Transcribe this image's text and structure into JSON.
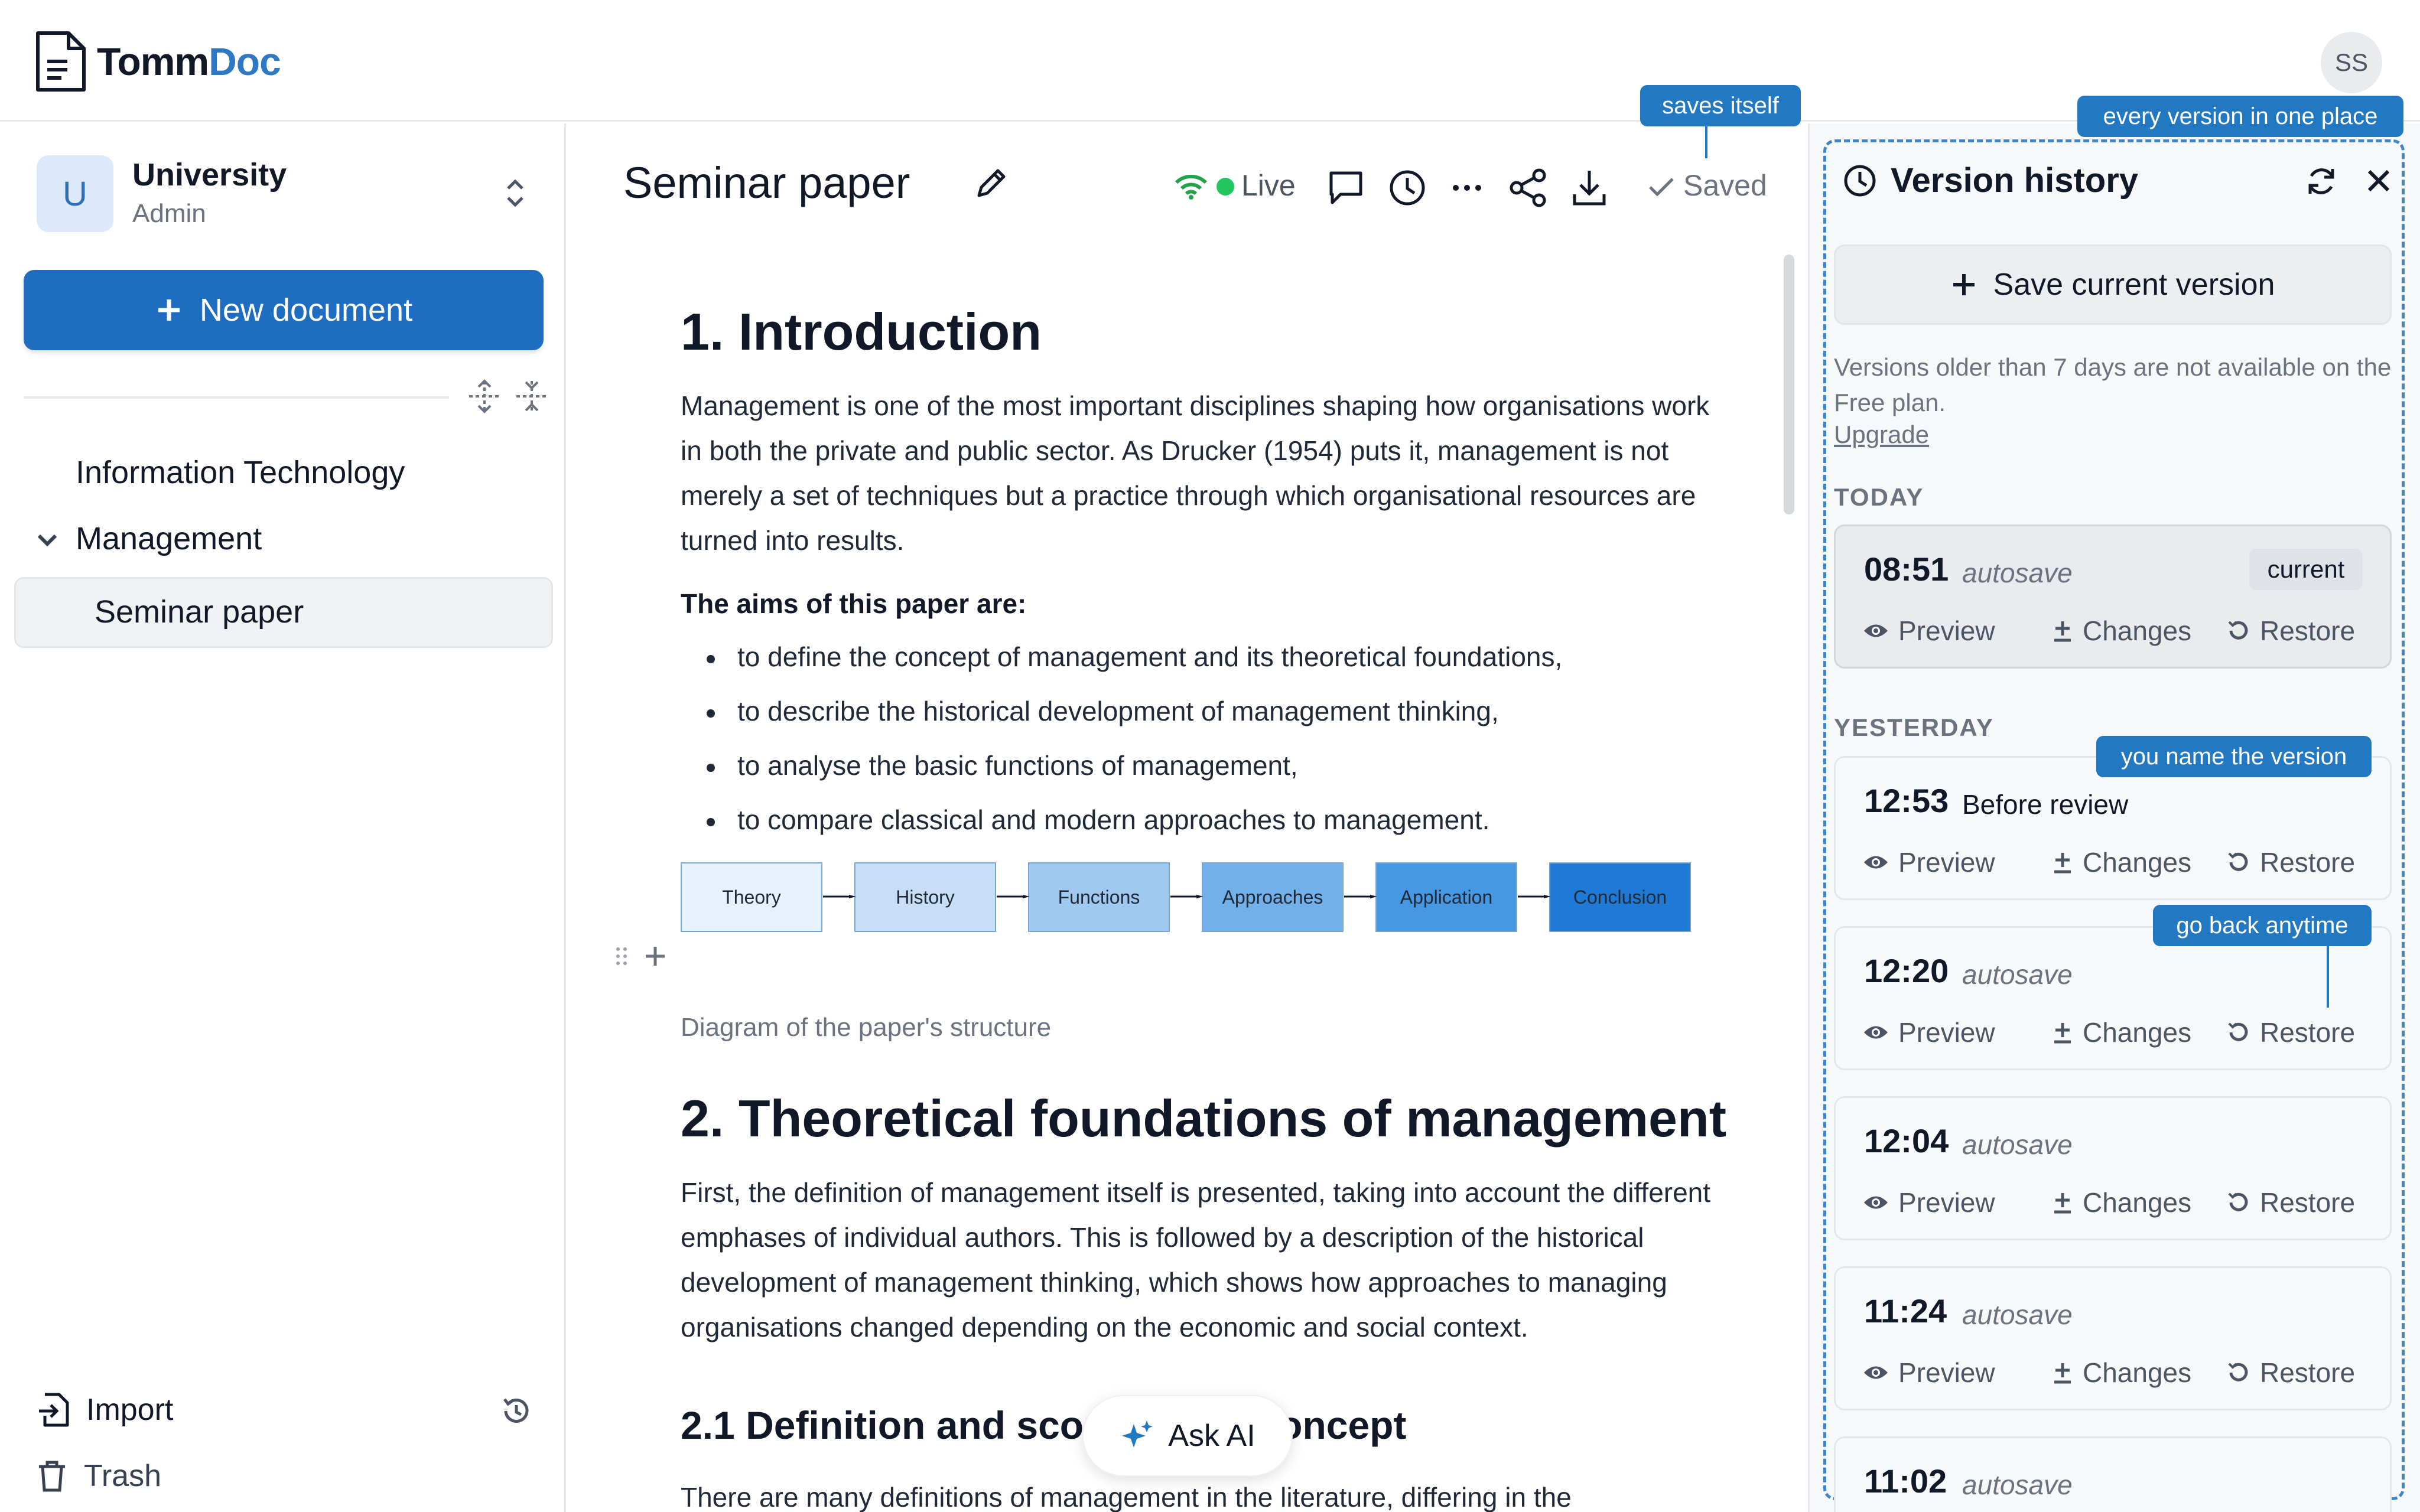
{
  "app": {
    "logo_text_part1": "Tomm",
    "logo_text_part2": "Doc",
    "user_initials": "SS"
  },
  "sidebar": {
    "workspace_initial": "U",
    "workspace_name": "University",
    "workspace_role": "Admin",
    "new_document_label": "New document",
    "tree": [
      {
        "label": "Information Technology"
      },
      {
        "label": "Management"
      },
      {
        "label": "Seminar paper"
      }
    ],
    "import_label": "Import",
    "trash_label": "Trash"
  },
  "editor": {
    "doc_title": "Seminar paper",
    "live_label": "Live",
    "saved_label": "Saved",
    "heading1": "1. Introduction",
    "intro_paragraph": "Management is one of the most important disciplines shaping how organisations work in both the private and public sector. As Drucker (1954) puts it, management is not merely a set of techniques but a practice through which organisational resources are turned into results.",
    "aims_heading": "The aims of this paper are:",
    "aims": [
      "to define the concept of management and its theoretical foundations,",
      "to describe the historical development of management thinking,",
      "to analyse the basic functions of management,",
      "to compare classical and modern approaches to management."
    ],
    "diagram_steps": [
      "Theory",
      "History",
      "Functions",
      "Approaches",
      "Application",
      "Conclusion"
    ],
    "diagram_caption": "Diagram of the paper's structure",
    "heading2": "2. Theoretical foundations of management",
    "section2_paragraph": "First, the definition of management itself is presented, taking into account the different emphases of individual authors. This is followed by a description of the historical development of management thinking, which shows how approaches to managing organisations changed depending on the economic and social context.",
    "heading2_1": "2.1 Definition and scope of the concept",
    "section2_1_paragraph": "There are many definitions of management in the literature, differing in the",
    "ask_ai_label": "Ask AI"
  },
  "version_history": {
    "title": "Version history",
    "save_label": "Save current version",
    "note": "Versions older than 7 days are not available on the Free plan.",
    "upgrade_label": "Upgrade",
    "today_label": "TODAY",
    "yesterday_label": "YESTERDAY",
    "preview_label": "Preview",
    "changes_label": "Changes",
    "restore_label": "Restore",
    "current_badge": "current",
    "versions": [
      {
        "time": "08:51",
        "label": "autosave"
      },
      {
        "time": "12:53",
        "label": "Before review"
      },
      {
        "time": "12:20",
        "label": "autosave"
      },
      {
        "time": "12:04",
        "label": "autosave"
      },
      {
        "time": "11:24",
        "label": "autosave"
      },
      {
        "time": "11:02",
        "label": "autosave"
      }
    ]
  },
  "callouts": {
    "saves_itself": "saves itself",
    "every_version": "every version in one place",
    "you_name": "you name the version",
    "go_back": "go back anytime"
  },
  "colors": {
    "accent": "#1f6dc1",
    "callout": "#2378c2",
    "live_green": "#22c55e"
  }
}
